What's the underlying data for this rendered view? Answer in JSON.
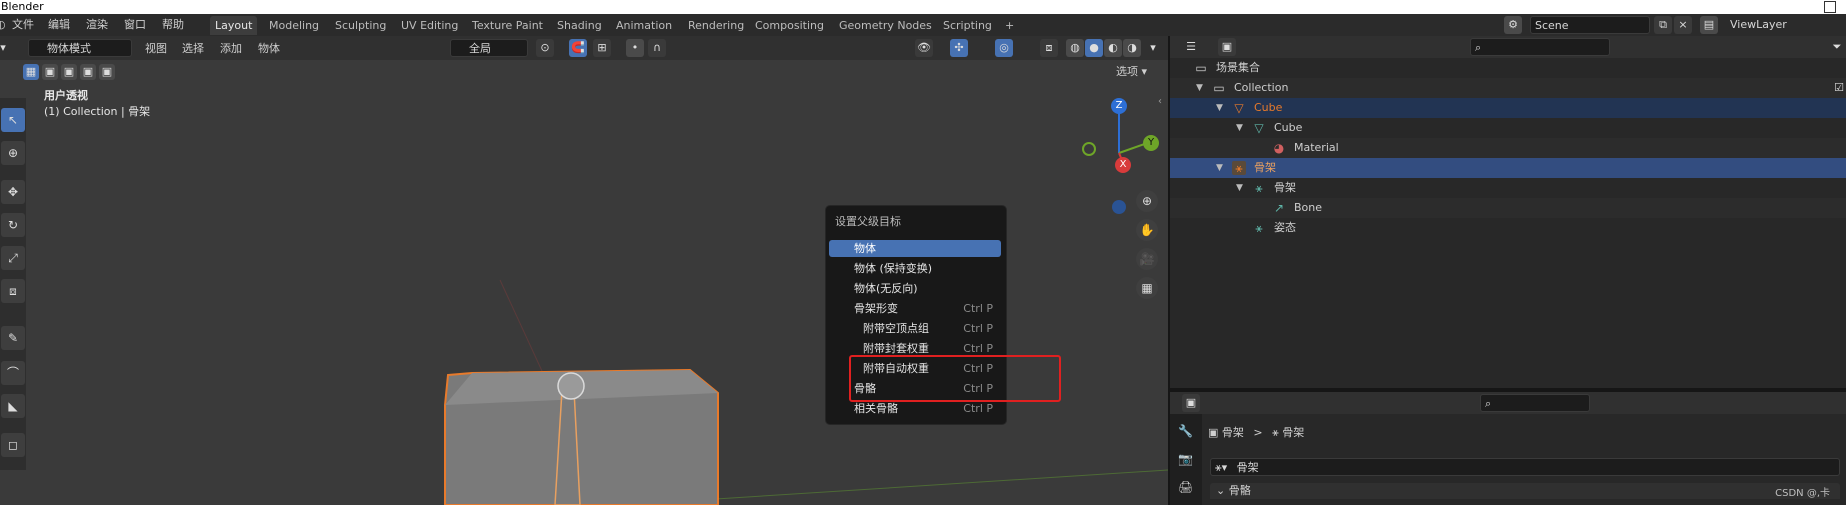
{
  "app": {
    "title": "Blender"
  },
  "menu": {
    "items": [
      "文件",
      "编辑",
      "渲染",
      "窗口",
      "帮助"
    ]
  },
  "workspaces": [
    "Layout",
    "Modeling",
    "Sculpting",
    "UV Editing",
    "Texture Paint",
    "Shading",
    "Animation",
    "Rendering",
    "Compositing",
    "Geometry Nodes",
    "Scripting"
  ],
  "workspace_add": "+",
  "scene": {
    "value": "Scene"
  },
  "view_layer": {
    "value": "ViewLayer"
  },
  "viewport_header": {
    "mode": "物体模式",
    "menus": [
      "视图",
      "选择",
      "添加",
      "物体"
    ],
    "orientation": "全局",
    "options_label": "选项"
  },
  "viewport_overlay": {
    "view_name": "用户透视",
    "collection_info": "(1) Collection | 骨架"
  },
  "gizmo_axes": {
    "z": "Z",
    "y": "Y",
    "x": "X"
  },
  "context_menu": {
    "title": "设置父级目标",
    "items": [
      {
        "label": "物体",
        "shortcut": ""
      },
      {
        "label": "物体 (保持变换)",
        "shortcut": ""
      },
      {
        "label": "物体(无反向)",
        "shortcut": ""
      },
      {
        "label": "骨架形变",
        "shortcut": "Ctrl P"
      },
      {
        "label": "附带空顶点组",
        "shortcut": "Ctrl P"
      },
      {
        "label": "附带封套权重",
        "shortcut": "Ctrl P"
      },
      {
        "label": "附带自动权重",
        "shortcut": "Ctrl P"
      },
      {
        "label": "骨骼",
        "shortcut": "Ctrl P"
      },
      {
        "label": "相关骨骼",
        "shortcut": "Ctrl P"
      }
    ],
    "highlighted_index": 0
  },
  "outliner": {
    "root": "场景集合",
    "rows": [
      {
        "label": "Collection"
      },
      {
        "label": "Cube"
      },
      {
        "label": "Cube"
      },
      {
        "label": "Material"
      },
      {
        "label": "骨架"
      },
      {
        "label": "骨架"
      },
      {
        "label": "Bone"
      },
      {
        "label": "姿态"
      }
    ]
  },
  "properties": {
    "breadcrumb_a": "骨架",
    "breadcrumb_sep": ">",
    "breadcrumb_b": "骨架",
    "data_name": "骨架",
    "section": "骨骼"
  },
  "watermark": "CSDN @,卡",
  "colors": {
    "accent": "#4772b3",
    "selection": "#334d80",
    "highlight_box": "#e02020",
    "object_orange": "#e87a2b"
  }
}
